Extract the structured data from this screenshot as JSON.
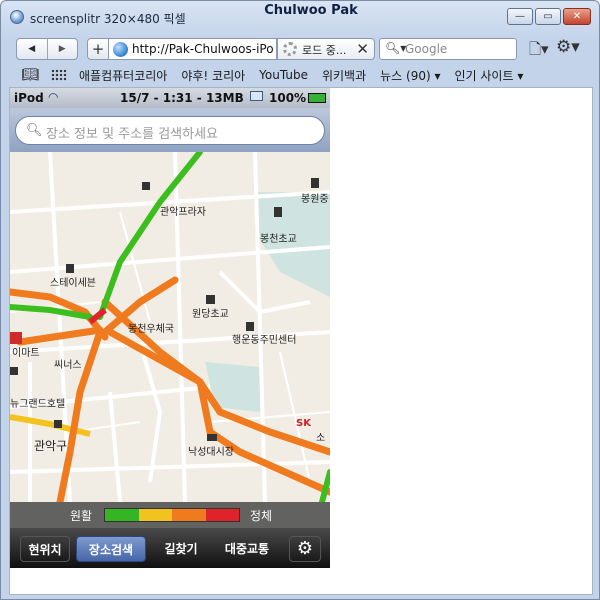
{
  "window": {
    "left_title": "screensplitr 320×480 픽셀",
    "title": "Chulwoo Pak",
    "buttons": {
      "minimize": "—",
      "maximize": "▭",
      "close": "✕"
    }
  },
  "toolbar": {
    "back": "◀",
    "forward": "▶",
    "add": "+",
    "url": "http://Pak-Chulwoos-iPod",
    "tab_label": "로드 중...",
    "tab_close": "✕",
    "search_placeholder": "Google",
    "page_menu": "🗋▾",
    "settings_menu": "⚙▾"
  },
  "bookmarks": {
    "items": [
      "애플컴퓨터코리아",
      "야후! 코리아",
      "YouTube",
      "위키백과",
      "뉴스 (90) ▾",
      "인기 사이트 ▾"
    ]
  },
  "phone": {
    "status": {
      "device": "iPod",
      "time": "15/7 - 1:31 - 13MB",
      "battery": "100%"
    },
    "search_placeholder": "장소 정보 및 주소를 검색하세요",
    "map_labels": {
      "l1": "관악프라자",
      "l2": "봉원중",
      "l3": "봉천초교",
      "l4": "스테이세븐",
      "l5": "원당초교",
      "l6": "봉천우체국",
      "l7": "행운동주민센터",
      "l8": "이마트",
      "l9": "씨너스",
      "l10": "뉴그랜드호텔",
      "l11": "관악구",
      "l12": "낙성대시장",
      "l13": "SK",
      "l14": "소"
    },
    "legend": {
      "left": "원활",
      "right": "정체",
      "colors": [
        "#35b523",
        "#f2c21e",
        "#f07a1e",
        "#e0232a"
      ]
    },
    "tabs": {
      "t1": "현위치",
      "t2": "장소검색",
      "t3": "길찾기",
      "t4": "대중교통",
      "t5": "⚙"
    }
  },
  "colors": {
    "road_green": "#3cbf1e",
    "road_orange": "#f07a1e",
    "road_yellow": "#f2c21e",
    "park": "#cfe4e0",
    "accent": "#4566a8"
  }
}
